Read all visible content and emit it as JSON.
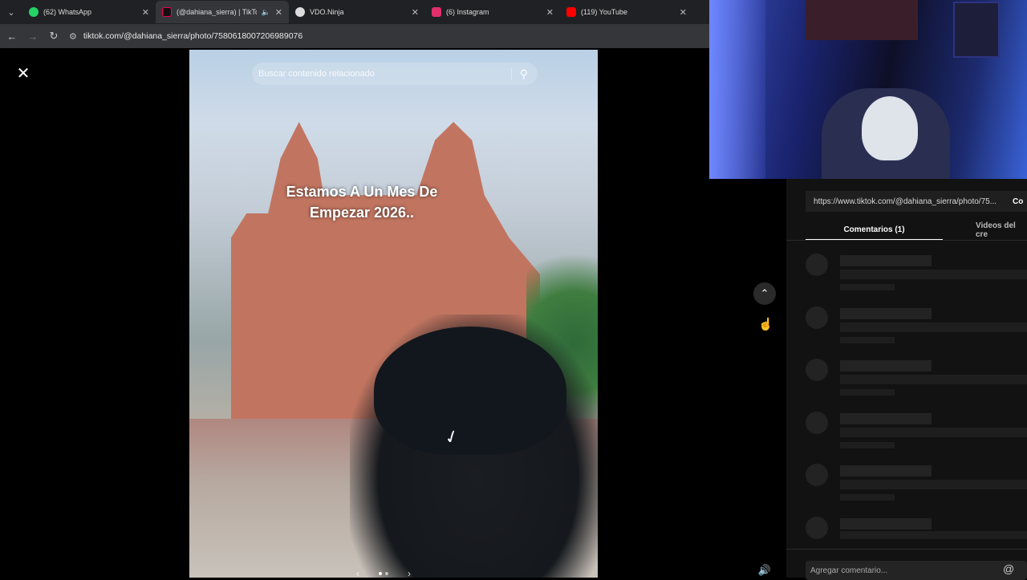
{
  "browser": {
    "tabs": [
      {
        "label": "(62) WhatsApp",
        "icon": "whatsapp-icon",
        "color": "#25d366",
        "active": false
      },
      {
        "label": "(@dahiana_sierra) | TikTok",
        "icon": "tiktok-icon",
        "color": "#ff0050",
        "active": true
      },
      {
        "label": "VDO.Ninja",
        "icon": "vdo-ninja-icon",
        "color": "#dddddd",
        "active": false
      },
      {
        "label": "(6) Instagram",
        "icon": "instagram-icon",
        "color": "#e1306c",
        "active": false
      },
      {
        "label": "(119) YouTube",
        "icon": "youtube-icon",
        "color": "#ff0000",
        "active": false
      }
    ],
    "url": "tiktok.com/@dahiana_sierra/photo/7580618007206989076"
  },
  "photo": {
    "search_placeholder": "Buscar contenido relacionado",
    "caption": "Estamos A Un Mes De\nEmpezar 2026..",
    "slide_count": 2,
    "slide_active": 1
  },
  "sidebar": {
    "share_link": "https://www.tiktok.com/@dahiana_sierra/photo/75...",
    "copy_label": "Co",
    "tabs": [
      "Comentarios (1)",
      "Videos del cre"
    ],
    "comment_placeholder": "Agregar comentario..."
  }
}
